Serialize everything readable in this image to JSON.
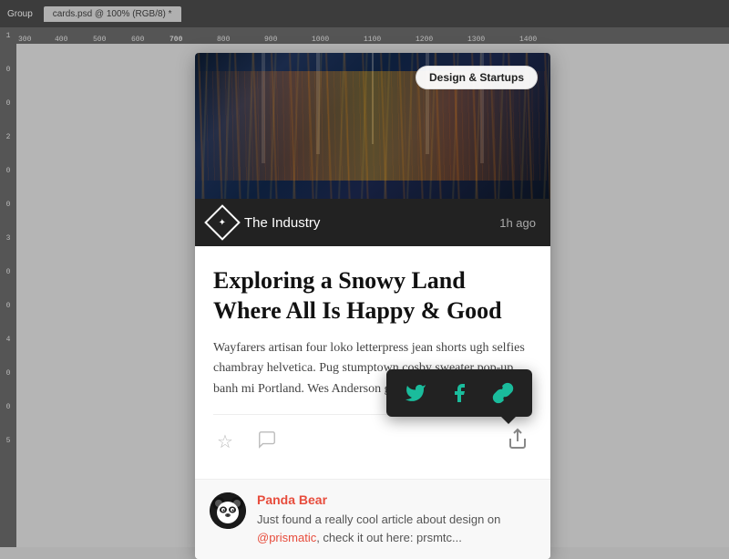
{
  "ps_bar": {
    "app_name": "Group",
    "tabs": [
      {
        "label": "cards.psd @ 100% (RGB/8) *",
        "active": true
      }
    ]
  },
  "ruler": {
    "h_marks": [
      "700",
      "800",
      "900",
      "1000",
      "1100",
      "1200",
      "1300",
      "1400"
    ],
    "v_marks": [
      "100",
      "200",
      "300",
      "400",
      "500"
    ]
  },
  "card": {
    "badge": "Design & Startups",
    "source_name": "The Industry",
    "source_time": "1h ago",
    "title": "Exploring a Snowy Land Where All Is Happy & Good",
    "excerpt": "Wayfarers artisan four loko letterpress jean shorts ugh selfies chambray helvetica. Pug stumptown cosby sweater pop-up banh mi Portland. Wes Anderson godard e",
    "actions": {
      "favorite_label": "★",
      "comment_label": "💬",
      "share_label": "↗"
    },
    "share_popup": {
      "twitter_label": "Twitter",
      "facebook_label": "Facebook",
      "link_label": "Link"
    },
    "comment": {
      "author": "Panda Bear",
      "text": "Just found a really cool article about design on @prismatic, check it out here: prsmtc...",
      "mention": "@prismatic"
    }
  }
}
